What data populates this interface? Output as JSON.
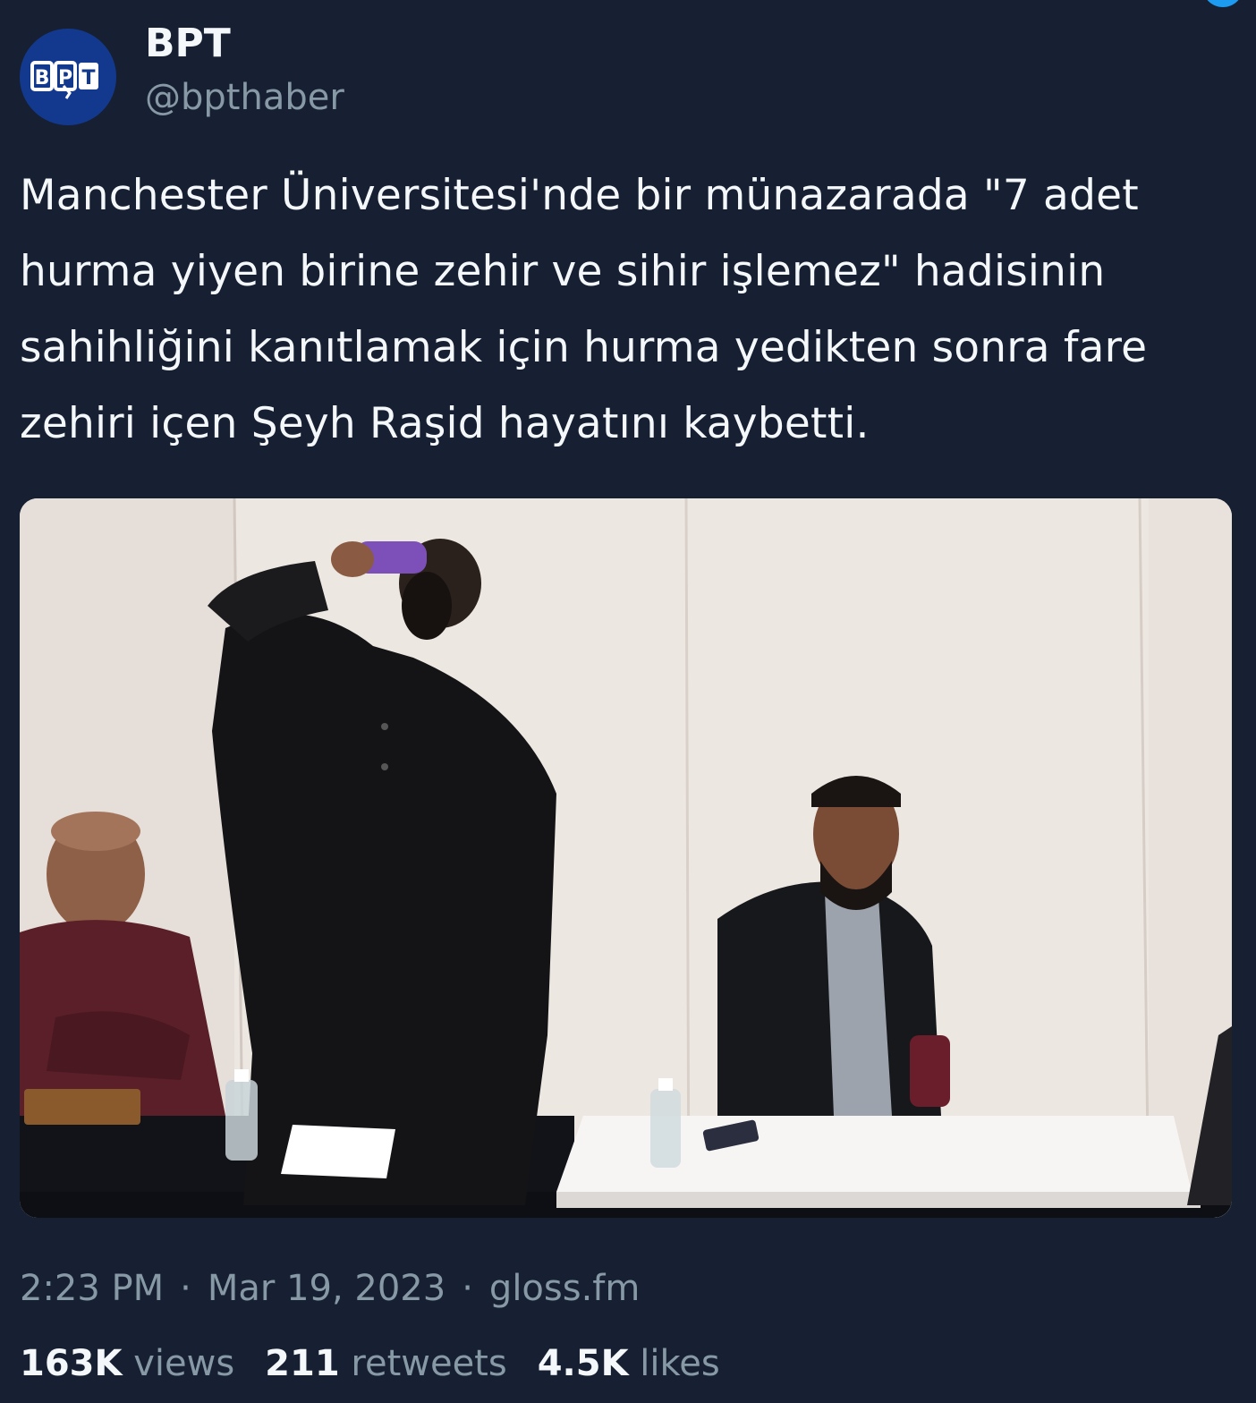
{
  "author": {
    "display_name": "BPT",
    "handle": "@bpthaber",
    "avatar_logo_text": "BPT"
  },
  "tweet": {
    "text": "Manchester Üniversitesi'nde bir münazarada \"7 adet hurma yiyen birine zehir ve sihir işlemez\" hadisinin sahihliğini kanıtlamak için hurma yedikten sonra fare zehiri içen Şeyh Raşid hayatını kaybetti.",
    "media_description": "photo"
  },
  "meta": {
    "time": "2:23 PM",
    "separator": "·",
    "date": "Mar 19, 2023",
    "source": "gloss.fm"
  },
  "stats": {
    "views_count": "163K",
    "views_label": "views",
    "retweets_count": "211",
    "retweets_label": "retweets",
    "likes_count": "4.5K",
    "likes_label": "likes"
  },
  "colors": {
    "background": "#162032",
    "text_primary": "#f5f8fa",
    "text_secondary": "#8899a6",
    "accent": "#1d9bf0",
    "avatar_bg": "#13398e"
  }
}
